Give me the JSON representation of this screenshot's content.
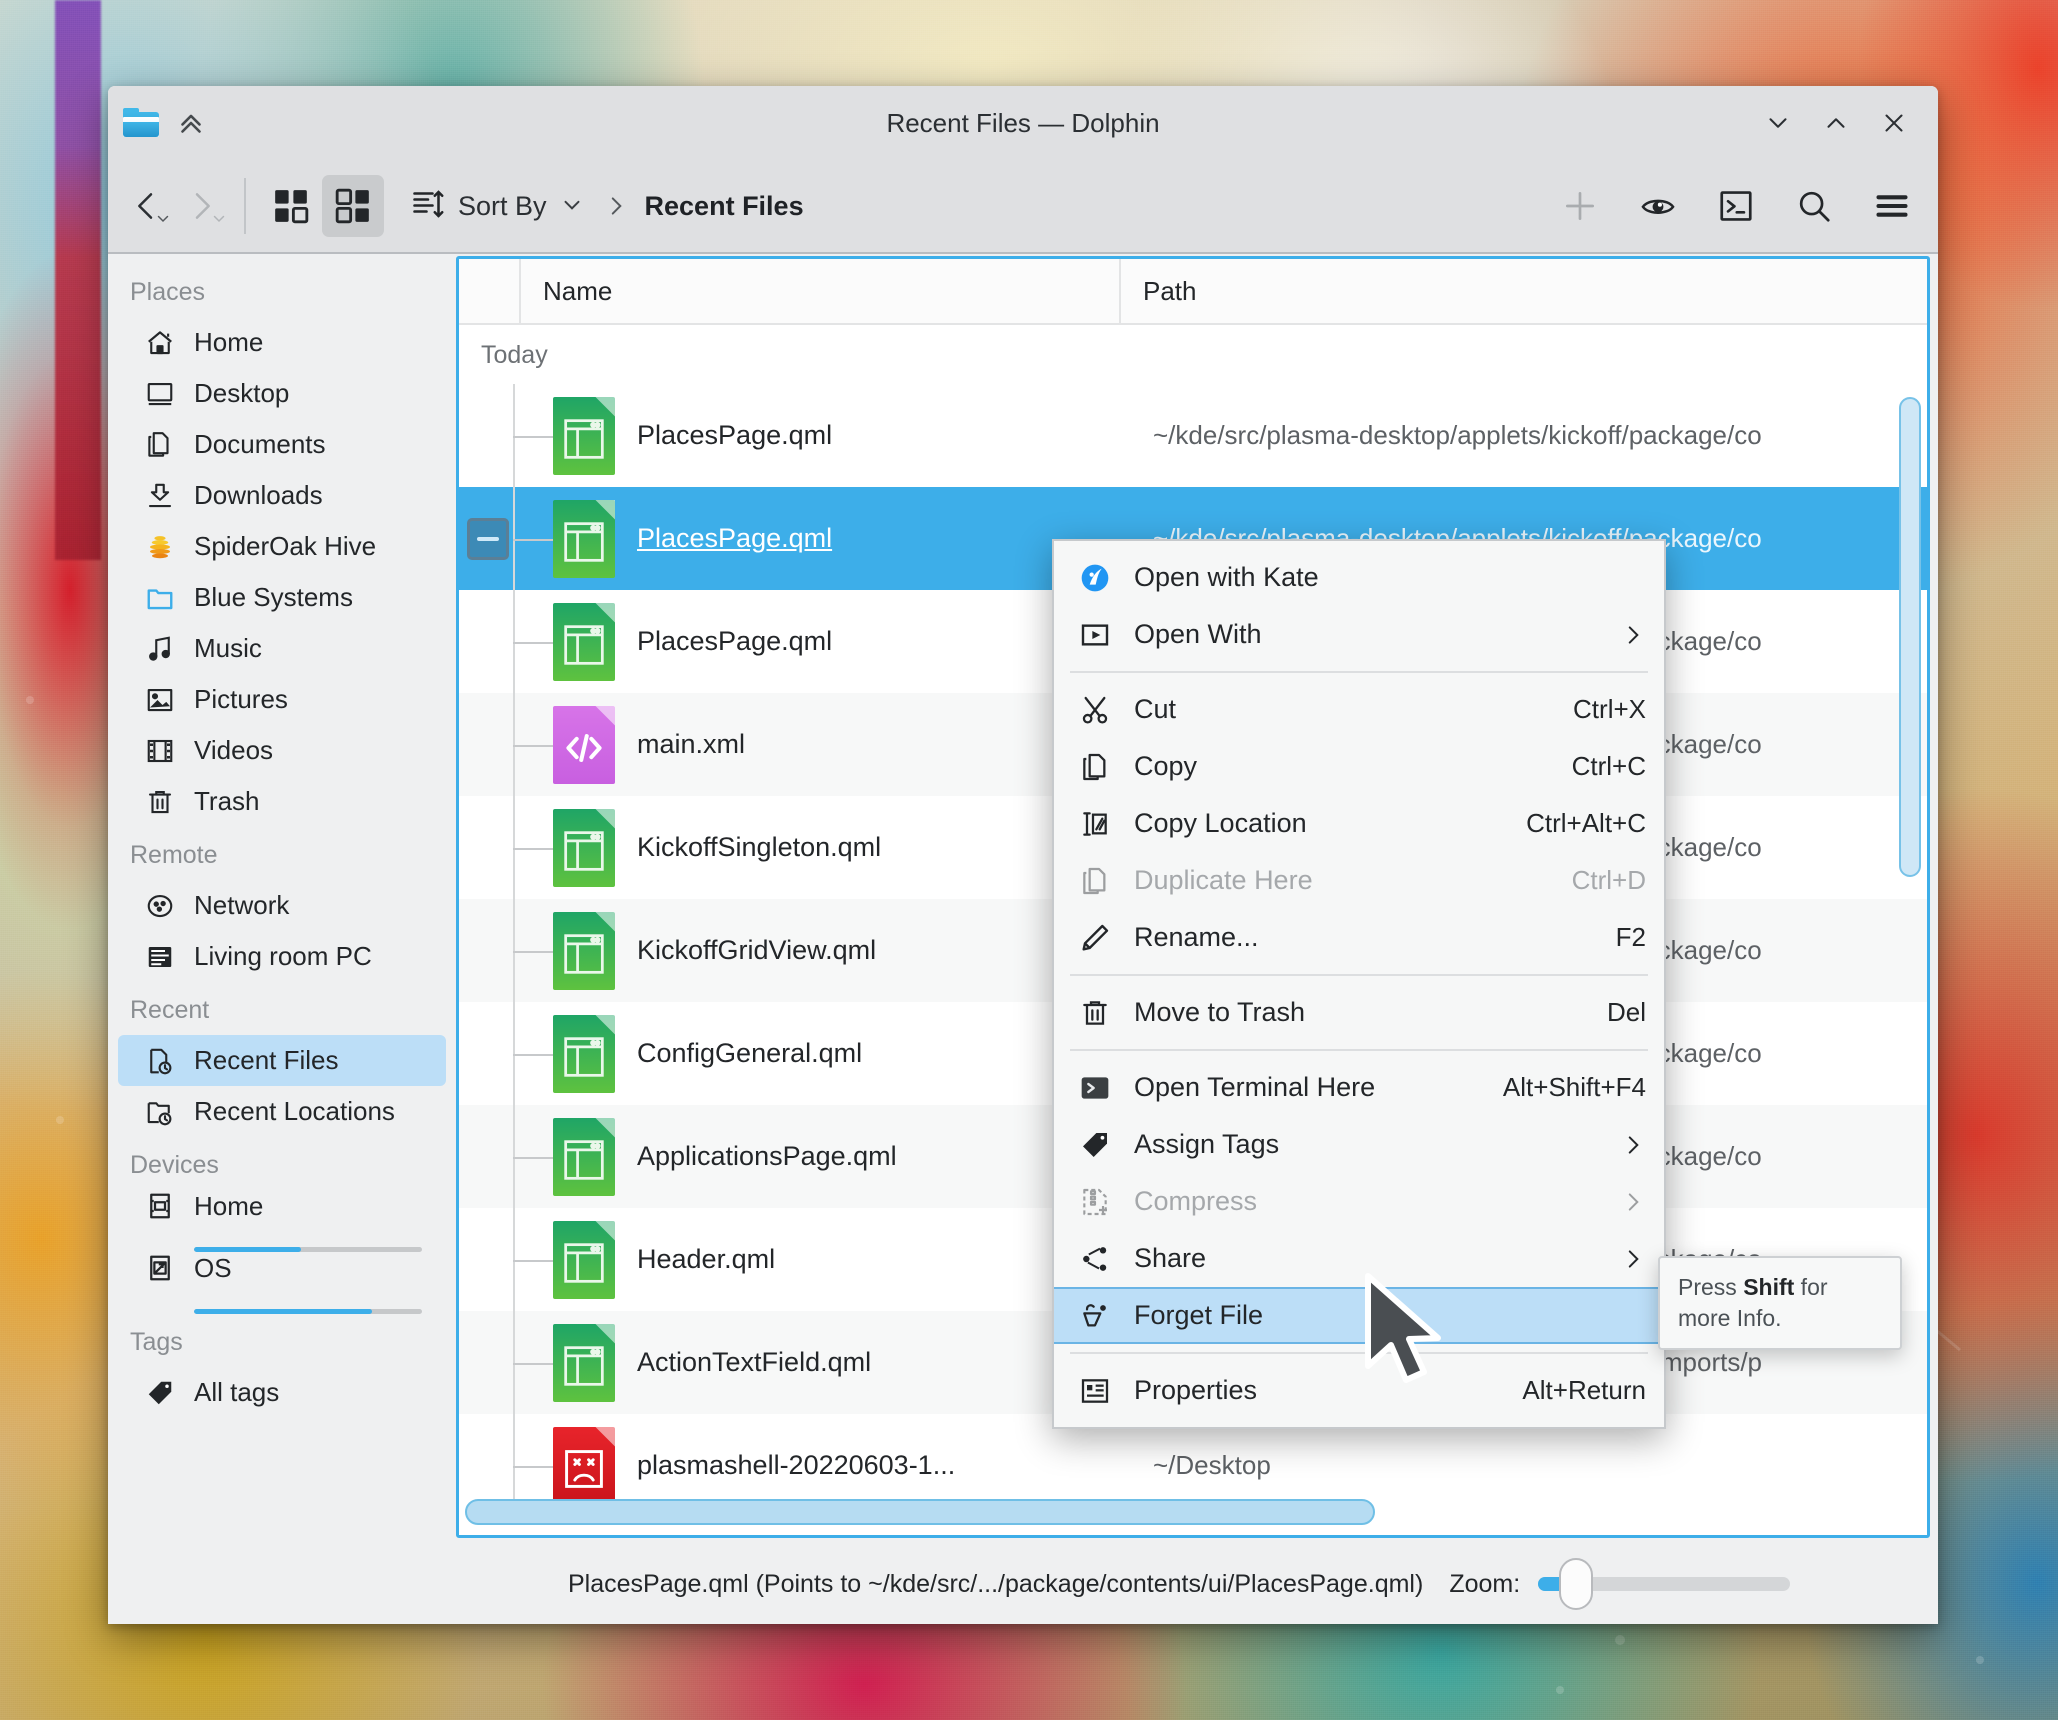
{
  "window": {
    "title": "Recent Files — Dolphin",
    "icon": "folder-icon",
    "controls": {
      "minimize": "minimize-icon",
      "maximize": "maximize-icon",
      "close": "close-icon"
    }
  },
  "toolbar": {
    "back_label": "Back",
    "forward_label": "Forward",
    "view_icons_label": "Icons View",
    "view_details_label": "Details View",
    "sort_by_label": "Sort By",
    "breadcrumb_current": "Recent Files",
    "actions": [
      {
        "name": "new-tab-icon",
        "label": "New Tab"
      },
      {
        "name": "preview-icon",
        "label": "Show Preview"
      },
      {
        "name": "terminal-icon",
        "label": "Open Terminal"
      },
      {
        "name": "search-icon",
        "label": "Find File"
      },
      {
        "name": "hamburger-menu-icon",
        "label": "Menu"
      }
    ]
  },
  "sidebar": {
    "sections": [
      {
        "title": "Places",
        "items": [
          {
            "label": "Home",
            "icon": "home-icon"
          },
          {
            "label": "Desktop",
            "icon": "desktop-icon"
          },
          {
            "label": "Documents",
            "icon": "documents-icon"
          },
          {
            "label": "Downloads",
            "icon": "download-icon"
          },
          {
            "label": "SpiderOak Hive",
            "icon": "hive-icon"
          },
          {
            "label": "Blue Systems",
            "icon": "folder-blue-icon"
          },
          {
            "label": "Music",
            "icon": "music-icon"
          },
          {
            "label": "Pictures",
            "icon": "pictures-icon"
          },
          {
            "label": "Videos",
            "icon": "videos-icon"
          },
          {
            "label": "Trash",
            "icon": "trash-icon"
          }
        ]
      },
      {
        "title": "Remote",
        "items": [
          {
            "label": "Network",
            "icon": "network-icon"
          },
          {
            "label": "Living room PC",
            "icon": "server-icon"
          }
        ]
      },
      {
        "title": "Recent",
        "items": [
          {
            "label": "Recent Files",
            "icon": "recent-file-icon",
            "selected": true
          },
          {
            "label": "Recent Locations",
            "icon": "recent-folder-icon"
          }
        ]
      },
      {
        "title": "Devices",
        "items": [
          {
            "label": "Home",
            "icon": "drive-icon",
            "usage_percent": 47
          },
          {
            "label": "OS",
            "icon": "drive-os-icon",
            "usage_percent": 78
          }
        ]
      },
      {
        "title": "Tags",
        "items": [
          {
            "label": "All tags",
            "icon": "tag-icon"
          }
        ]
      }
    ]
  },
  "fileview": {
    "columns": [
      {
        "key": "name",
        "label": "Name"
      },
      {
        "key": "path",
        "label": "Path"
      }
    ],
    "group_label": "Today",
    "rows": [
      {
        "name": "PlacesPage.qml",
        "path": "~/kde/src/plasma-desktop/applets/kickoff/package/co",
        "kind": "qml",
        "selected": false
      },
      {
        "name": "PlacesPage.qml",
        "path": "~/kde/src/plasma-desktop/applets/kickoff/package/co",
        "kind": "qml",
        "selected": true
      },
      {
        "name": "PlacesPage.qml",
        "path": "~/kde/src/plasma-desktop/applets/kickoff/package/co",
        "kind": "qml",
        "selected": false
      },
      {
        "name": "main.xml",
        "path": "~/kde/src/plasma-desktop/applets/kickoff/package/co",
        "kind": "xml",
        "selected": false
      },
      {
        "name": "KickoffSingleton.qml",
        "path": "~/kde/src/plasma-desktop/applets/kickoff/package/co",
        "kind": "qml",
        "selected": false
      },
      {
        "name": "KickoffGridView.qml",
        "path": "~/kde/src/plasma-desktop/applets/kickoff/package/co",
        "kind": "qml",
        "selected": false
      },
      {
        "name": "ConfigGeneral.qml",
        "path": "~/kde/src/plasma-desktop/applets/kickoff/package/co",
        "kind": "qml",
        "selected": false
      },
      {
        "name": "ApplicationsPage.qml",
        "path": "~/kde/src/plasma-desktop/applets/kickoff/package/co",
        "kind": "qml",
        "selected": false
      },
      {
        "name": "Header.qml",
        "path": "~/kde/src/plasma-desktop/applets/kickoff/package/co",
        "kind": "qml",
        "selected": false
      },
      {
        "name": "ActionTextField.qml",
        "path": "~/kde/src/plasma-framework/src/declarativeimports/p",
        "kind": "qml",
        "selected": false
      },
      {
        "name": "plasmashell-20220603-1...",
        "path": "~/Desktop",
        "kind": "png",
        "selected": false
      }
    ]
  },
  "context_menu": {
    "items": [
      {
        "label": "Open with Kate",
        "icon": "kate-icon",
        "shortcut": "",
        "submenu": false,
        "disabled": false
      },
      {
        "label": "Open With",
        "icon": "open-with-icon",
        "shortcut": "",
        "submenu": true,
        "disabled": false
      },
      {
        "separator": true
      },
      {
        "label": "Cut",
        "icon": "scissors-icon",
        "shortcut": "Ctrl+X",
        "submenu": false,
        "disabled": false
      },
      {
        "label": "Copy",
        "icon": "copy-icon",
        "shortcut": "Ctrl+C",
        "submenu": false,
        "disabled": false
      },
      {
        "label": "Copy Location",
        "icon": "copy-location-icon",
        "shortcut": "Ctrl+Alt+C",
        "submenu": false,
        "disabled": false
      },
      {
        "label": "Duplicate Here",
        "icon": "duplicate-icon",
        "shortcut": "Ctrl+D",
        "submenu": false,
        "disabled": true
      },
      {
        "label": "Rename...",
        "icon": "pencil-icon",
        "shortcut": "F2",
        "submenu": false,
        "disabled": false
      },
      {
        "separator": true
      },
      {
        "label": "Move to Trash",
        "icon": "trash-icon",
        "shortcut": "Del",
        "submenu": false,
        "disabled": false
      },
      {
        "separator": true
      },
      {
        "label": "Open Terminal Here",
        "icon": "terminal-icon",
        "shortcut": "Alt+Shift+F4",
        "submenu": false,
        "disabled": false
      },
      {
        "label": "Assign Tags",
        "icon": "tag-icon",
        "shortcut": "",
        "submenu": true,
        "disabled": false
      },
      {
        "label": "Compress",
        "icon": "compress-icon",
        "shortcut": "",
        "submenu": true,
        "disabled": true
      },
      {
        "label": "Share",
        "icon": "share-icon",
        "shortcut": "",
        "submenu": true,
        "disabled": false
      },
      {
        "label": "Forget File",
        "icon": "forget-file-icon",
        "shortcut": "",
        "submenu": false,
        "disabled": false,
        "highlighted": true
      },
      {
        "separator": true
      },
      {
        "label": "Properties",
        "icon": "properties-icon",
        "shortcut": "Alt+Return",
        "submenu": false,
        "disabled": false
      }
    ]
  },
  "tooltip": {
    "prefix": "Press ",
    "strong": "Shift",
    "suffix": " for more Info."
  },
  "statusbar": {
    "text": "PlacesPage.qml (Points to ~/kde/src/.../package/contents/ui/PlacesPage.qml)",
    "zoom_label": "Zoom:",
    "zoom_percent": 15
  },
  "colors": {
    "accent": "#3daee9",
    "selection": "#3daee9",
    "menu_highlight": "#bcdef7",
    "window_bg": "#eff0f1",
    "titlebar_bg": "#dfe0e2",
    "text": "#232629"
  }
}
